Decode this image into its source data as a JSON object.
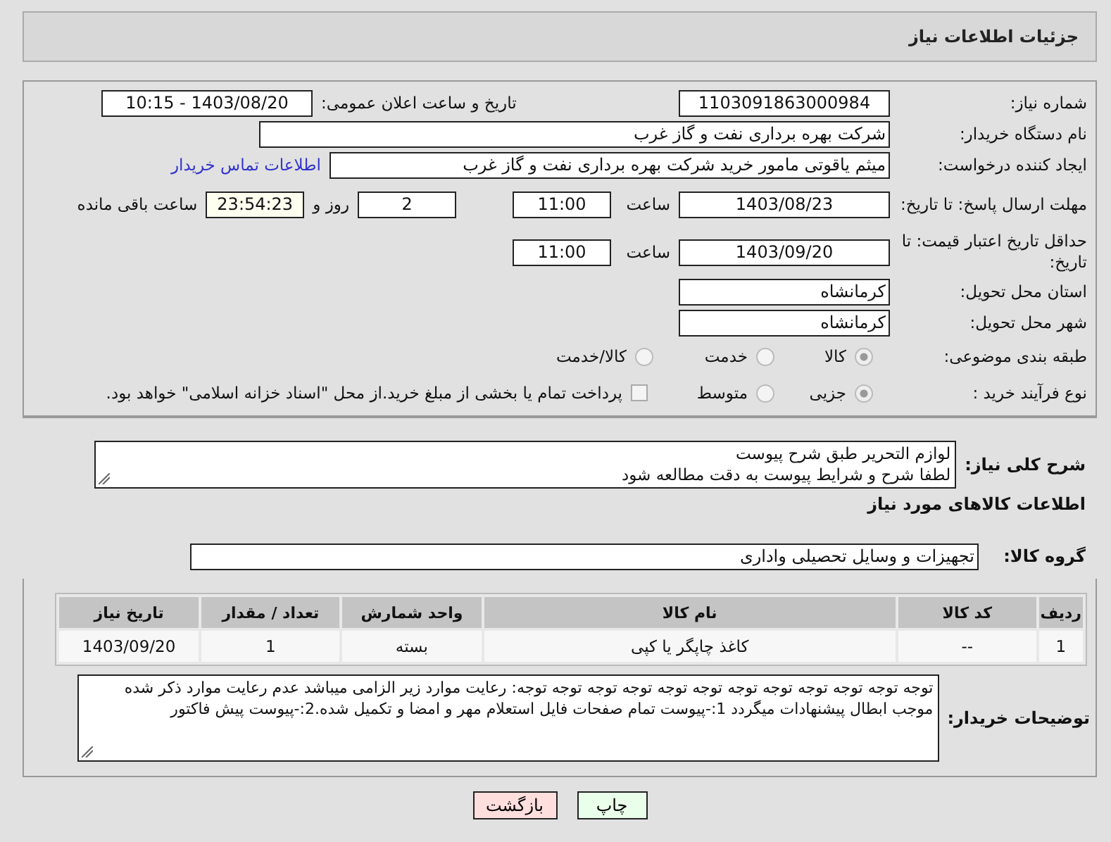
{
  "header": {
    "title": "جزئیات اطلاعات نیاز"
  },
  "need_number": {
    "label": "شماره نیاز:",
    "value": "1103091863000984"
  },
  "announcement": {
    "label": "تاریخ و ساعت اعلان عمومی:",
    "value": "1403/08/20 - 10:15"
  },
  "buyer_org": {
    "label": "نام دستگاه خریدار:",
    "value": "شرکت بهره برداری نفت و گاز غرب"
  },
  "creator": {
    "label": "ایجاد کننده درخواست:",
    "value": "میثم یاقوتی مامور خرید شرکت بهره برداری نفت و گاز غرب",
    "link": "اطلاعات تماس خریدار"
  },
  "deadline": {
    "label": "مهلت ارسال پاسخ: تا تاریخ:",
    "date": "1403/08/23",
    "time_label": "ساعت",
    "time": "11:00",
    "days": "2",
    "days_label": "روز و",
    "remaining": "23:54:23",
    "remaining_label": "ساعت باقی مانده"
  },
  "validity": {
    "label": "حداقل تاریخ اعتبار قیمت: تا تاریخ:",
    "date": "1403/09/20",
    "time_label": "ساعت",
    "time": "11:00"
  },
  "province": {
    "label": "استان محل تحویل:",
    "value": "کرمانشاه"
  },
  "city": {
    "label": "شهر محل تحویل:",
    "value": "کرمانشاه"
  },
  "category": {
    "label": "طبقه بندی موضوعی:",
    "options": [
      {
        "label": "کالا",
        "selected": true
      },
      {
        "label": "خدمت",
        "selected": false
      },
      {
        "label": "کالا/خدمت",
        "selected": false
      }
    ]
  },
  "purchase_type": {
    "label": "نوع فرآیند خرید :",
    "options": [
      {
        "label": "جزیی",
        "selected": true
      },
      {
        "label": "متوسط",
        "selected": false
      }
    ],
    "treasury": {
      "checked": false,
      "label": "پرداخت تمام یا بخشی از مبلغ خرید.از محل \"اسناد خزانه اسلامی\" خواهد بود."
    }
  },
  "description": {
    "label": "شرح کلی نیاز:",
    "lines": [
      "لوازم التحریر طبق شرح پیوست",
      "لطفا شرح و شرایط پیوست به دقت مطالعه شود"
    ]
  },
  "items_title": "اطلاعات کالاهای مورد نیاز",
  "goods_group": {
    "label": "گروه کالا:",
    "value": "تجهیزات و وسایل تحصیلی واداری"
  },
  "table": {
    "columns": [
      "ردیف",
      "کد کالا",
      "نام کالا",
      "واحد شمارش",
      "تعداد / مقدار",
      "تاریخ نیاز"
    ],
    "rows": [
      [
        "1",
        "--",
        "کاغذ چاپگر یا کپی",
        "بسته",
        "1",
        "1403/09/20"
      ]
    ]
  },
  "buyer_notes": {
    "label": "توضیحات خریدار:",
    "value": "توجه توجه توجه توجه توجه توجه توجه توجه توجه توجه توجه توجه: رعایت موارد زیر الزامی میباشد عدم رعایت موارد ذکر شده موجب ابطال پیشنهادات میگردد 1:-پیوست تمام صفحات  فایل استعلام مهر و امضا و تکمیل شده.2:-پیوست پیش فاکتور"
  },
  "buttons": [
    {
      "label": "چاپ",
      "kind": "print"
    },
    {
      "label": "بازگشت",
      "kind": "back"
    }
  ]
}
